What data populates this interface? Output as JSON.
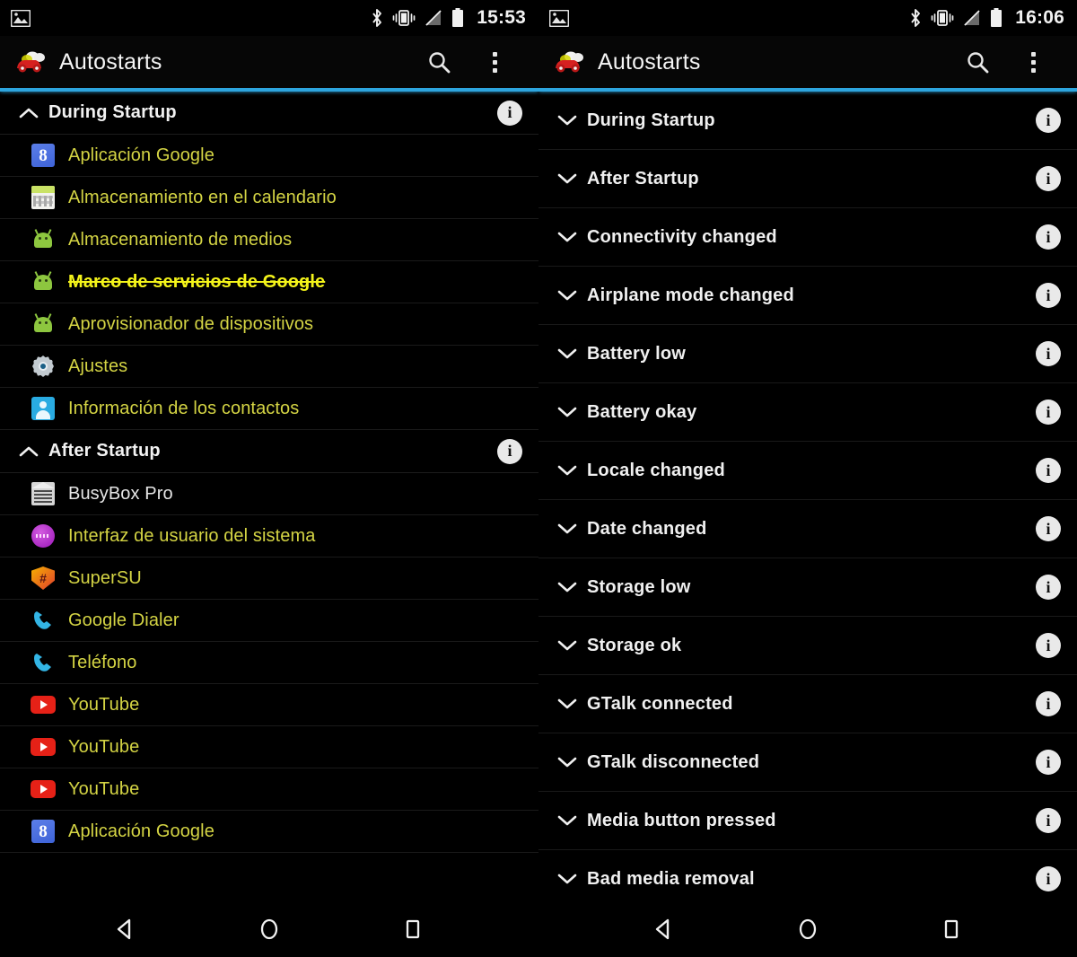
{
  "left": {
    "status_bar": {
      "time": "15:53",
      "left_icons": [
        "image-icon"
      ],
      "right_icons": [
        "bluetooth-icon",
        "vibrate-icon",
        "no-sim-icon",
        "battery-icon"
      ]
    },
    "action_bar": {
      "title": "Autostarts",
      "app_icon": "red-car-icon",
      "search_icon": "search-icon",
      "overflow_icon": "overflow-menu-icon"
    },
    "sections": [
      {
        "title": "During Startup",
        "expanded": true,
        "chevron": "chevron-up-icon",
        "info": "info-icon",
        "items": [
          {
            "label": "Aplicación Google",
            "icon": "google-app-icon",
            "style": "enabled"
          },
          {
            "label": "Almacenamiento en el calendario",
            "icon": "calendar-storage-icon",
            "style": "enabled"
          },
          {
            "label": "Almacenamiento de medios",
            "icon": "android-icon",
            "style": "enabled"
          },
          {
            "label": "Marco de servicios de Google",
            "icon": "android-icon",
            "style": "disabled"
          },
          {
            "label": "Aprovisionador de dispositivos",
            "icon": "android-icon",
            "style": "enabled"
          },
          {
            "label": "Ajustes",
            "icon": "settings-gear-icon",
            "style": "enabled"
          },
          {
            "label": "Información de los contactos",
            "icon": "contacts-icon",
            "style": "enabled"
          }
        ]
      },
      {
        "title": "After Startup",
        "expanded": true,
        "chevron": "chevron-up-icon",
        "info": "info-icon",
        "items": [
          {
            "label": "BusyBox Pro",
            "icon": "busybox-icon",
            "style": "white"
          },
          {
            "label": "Interfaz de usuario del sistema",
            "icon": "system-ui-icon",
            "style": "enabled"
          },
          {
            "label": "SuperSU",
            "icon": "supersu-icon",
            "style": "enabled"
          },
          {
            "label": "Google Dialer",
            "icon": "phone-icon",
            "style": "enabled"
          },
          {
            "label": "Teléfono",
            "icon": "phone-icon",
            "style": "enabled"
          },
          {
            "label": "YouTube",
            "icon": "youtube-icon",
            "style": "enabled"
          },
          {
            "label": "YouTube",
            "icon": "youtube-icon",
            "style": "enabled"
          },
          {
            "label": "YouTube",
            "icon": "youtube-icon",
            "style": "enabled"
          },
          {
            "label": "Aplicación Google",
            "icon": "google-app-icon",
            "style": "enabled"
          }
        ]
      }
    ],
    "nav_bar": {
      "back": "back-triangle-icon",
      "home": "home-circle-icon",
      "recents": "recents-square-icon"
    }
  },
  "right": {
    "status_bar": {
      "time": "16:06",
      "left_icons": [
        "image-icon"
      ],
      "right_icons": [
        "bluetooth-icon",
        "vibrate-icon",
        "no-sim-icon",
        "battery-icon"
      ]
    },
    "action_bar": {
      "title": "Autostarts",
      "app_icon": "red-car-icon",
      "search_icon": "search-icon",
      "overflow_icon": "overflow-menu-icon"
    },
    "events": [
      {
        "title": "During Startup",
        "chevron": "chevron-down-icon",
        "info": "info-icon"
      },
      {
        "title": "After Startup",
        "chevron": "chevron-down-icon",
        "info": "info-icon"
      },
      {
        "title": "Connectivity changed",
        "chevron": "chevron-down-icon",
        "info": "info-icon"
      },
      {
        "title": "Airplane mode changed",
        "chevron": "chevron-down-icon",
        "info": "info-icon"
      },
      {
        "title": "Battery low",
        "chevron": "chevron-down-icon",
        "info": "info-icon"
      },
      {
        "title": "Battery okay",
        "chevron": "chevron-down-icon",
        "info": "info-icon"
      },
      {
        "title": "Locale changed",
        "chevron": "chevron-down-icon",
        "info": "info-icon"
      },
      {
        "title": "Date changed",
        "chevron": "chevron-down-icon",
        "info": "info-icon"
      },
      {
        "title": "Storage low",
        "chevron": "chevron-down-icon",
        "info": "info-icon"
      },
      {
        "title": "Storage ok",
        "chevron": "chevron-down-icon",
        "info": "info-icon"
      },
      {
        "title": "GTalk connected",
        "chevron": "chevron-down-icon",
        "info": "info-icon"
      },
      {
        "title": "GTalk disconnected",
        "chevron": "chevron-down-icon",
        "info": "info-icon"
      },
      {
        "title": "Media button pressed",
        "chevron": "chevron-down-icon",
        "info": "info-icon"
      },
      {
        "title": "Bad media removal",
        "chevron": "chevron-down-icon",
        "info": "info-icon"
      }
    ],
    "nav_bar": {
      "back": "back-triangle-icon",
      "home": "home-circle-icon",
      "recents": "recents-square-icon"
    }
  },
  "colors": {
    "accent_rule": "#2da5de",
    "enabled_label": "#d4d444",
    "disabled_label": "#f4f41a",
    "white_label": "#e6e6e6",
    "background": "#000000",
    "info_badge": "#e9e9e9"
  },
  "info_glyph": "i"
}
